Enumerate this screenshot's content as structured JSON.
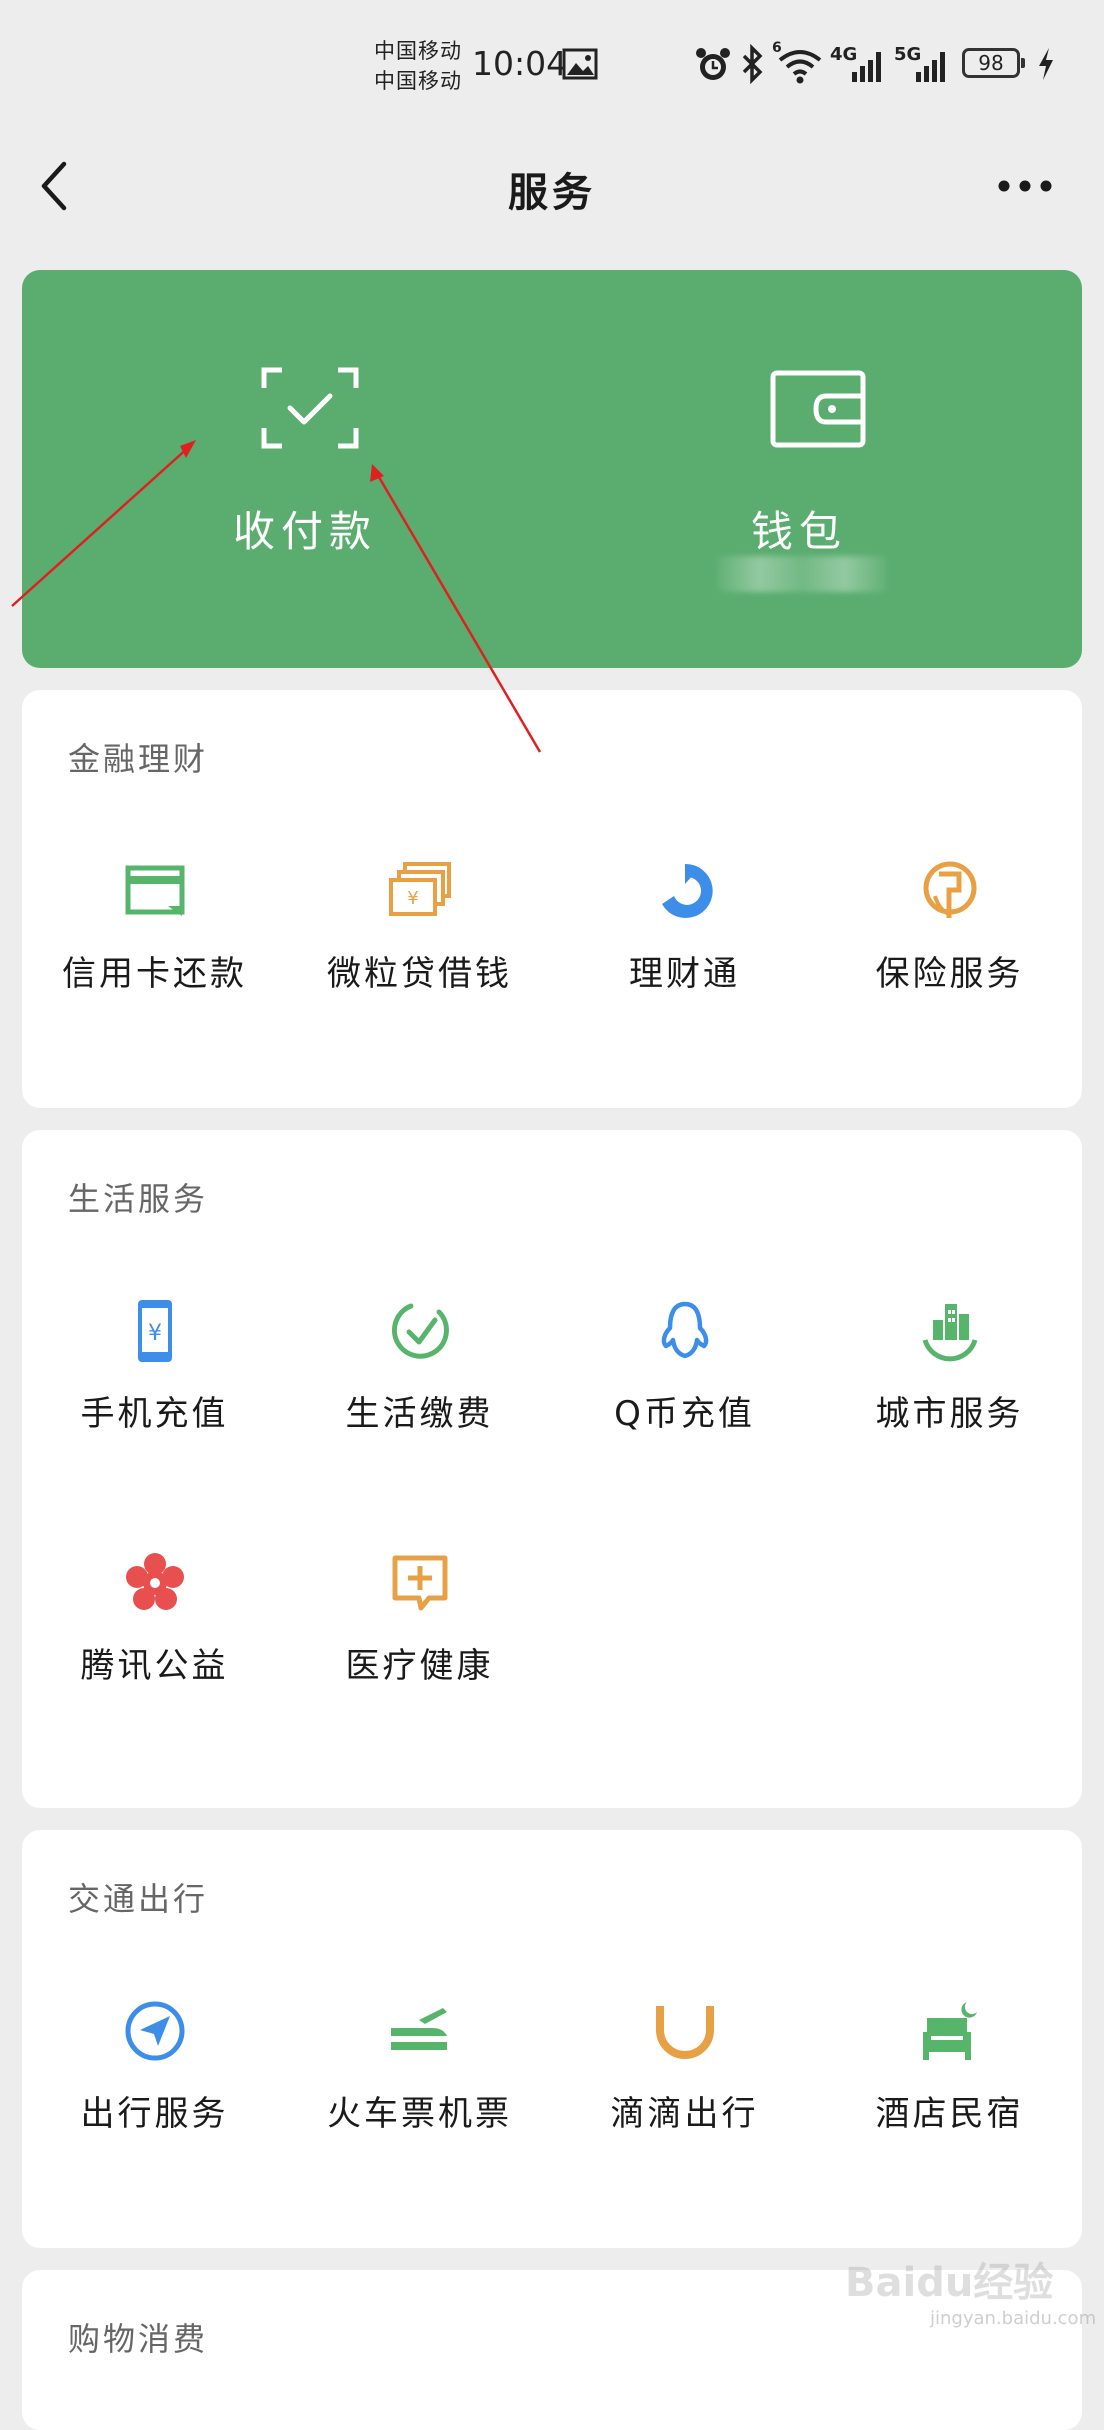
{
  "status": {
    "carrier1": "中国移动",
    "carrier2": "中国移动",
    "time": "10:04",
    "net_4g": "4G",
    "net_5g": "5G",
    "wifi_num": "6",
    "battery": "98"
  },
  "nav": {
    "title": "服务"
  },
  "wallet": {
    "pay_label": "收付款",
    "wallet_label": "钱包"
  },
  "sections": {
    "finance": {
      "title": "金融理财",
      "items": [
        "信用卡还款",
        "微粒贷借钱",
        "理财通",
        "保险服务"
      ]
    },
    "life": {
      "title": "生活服务",
      "items": [
        "手机充值",
        "生活缴费",
        "Q币充值",
        "城市服务",
        "腾讯公益",
        "医疗健康"
      ]
    },
    "transport": {
      "title": "交通出行",
      "items": [
        "出行服务",
        "火车票机票",
        "滴滴出行",
        "酒店民宿"
      ]
    },
    "shopping": {
      "title": "购物消费"
    }
  },
  "watermark": {
    "brand": "Baidu经验",
    "url": "jingyan.baidu.com"
  },
  "colors": {
    "wallet_green": "#5aad6f",
    "icon_green": "#57b56b",
    "icon_orange": "#e8a045",
    "icon_blue": "#3d8ee8",
    "icon_red": "#e85050",
    "annotation_red": "#e02020"
  }
}
